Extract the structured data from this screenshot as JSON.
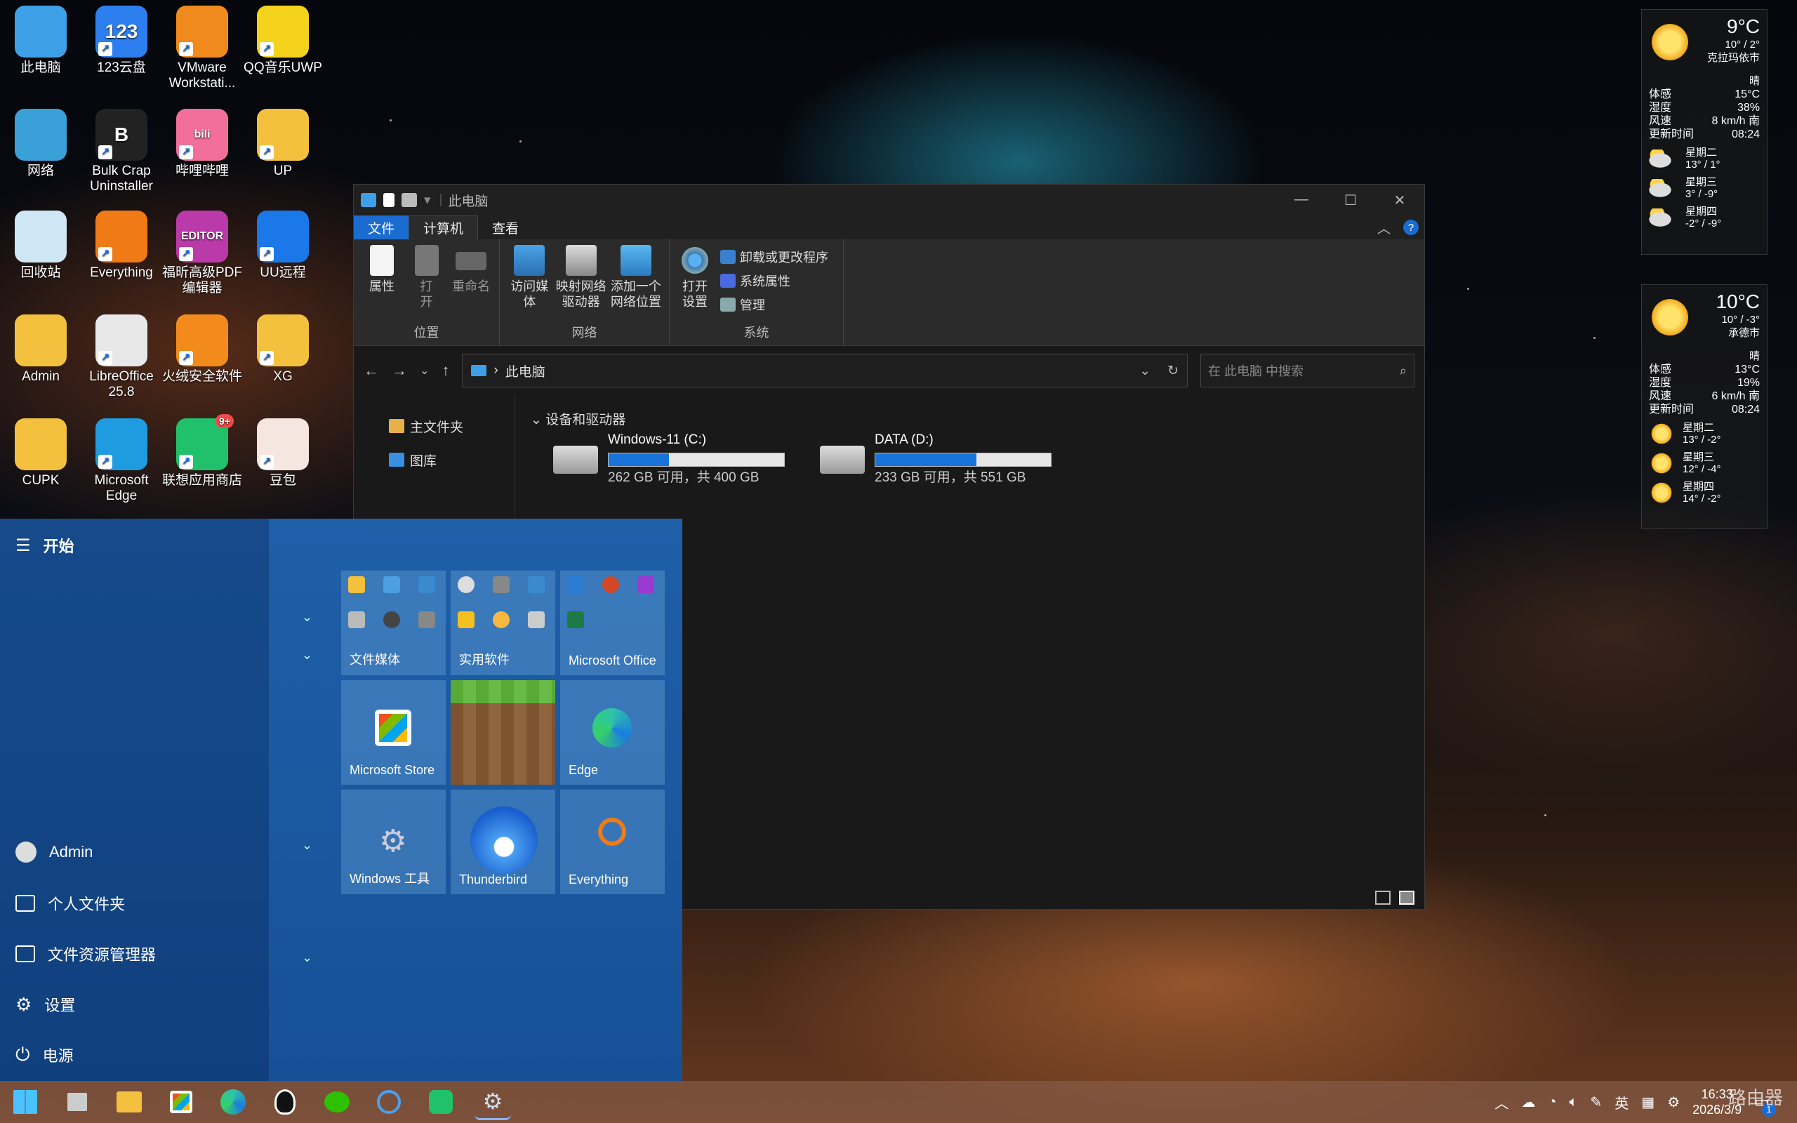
{
  "desktop": {
    "icons": [
      {
        "label": "此电脑",
        "color": "#3ea1e8"
      },
      {
        "label": "123云盘",
        "color": "#2d7ff0",
        "glyph": "123"
      },
      {
        "label": "VMware Workstati...",
        "color": "#f08a1c"
      },
      {
        "label": "QQ音乐UWP",
        "color": "#f5d31c"
      },
      {
        "label": "网络",
        "color": "#3aa0d8"
      },
      {
        "label": "Bulk Crap Uninstaller",
        "color": "#222",
        "glyph": "B"
      },
      {
        "label": "哔哩哔哩",
        "color": "#f26f9b",
        "glyph": "bili"
      },
      {
        "label": "UP",
        "color": "#f3c13e"
      },
      {
        "label": "回收站",
        "color": "#cfe6f5"
      },
      {
        "label": "Everything",
        "color": "#f07a16"
      },
      {
        "label": "福昕高级PDF编辑器",
        "color": "#b93aa8",
        "glyph": "EDITOR"
      },
      {
        "label": "UU远程",
        "color": "#1a78e8"
      },
      {
        "label": "Admin",
        "color": "#f3c13e"
      },
      {
        "label": "LibreOffice 25.8",
        "color": "#e8e8e8"
      },
      {
        "label": "火绒安全软件",
        "color": "#f28b1c"
      },
      {
        "label": "XG",
        "color": "#f3c13e"
      },
      {
        "label": "CUPK",
        "color": "#f3c13e"
      },
      {
        "label": "Microsoft Edge",
        "color": "#1f9be0"
      },
      {
        "label": "联想应用商店",
        "color": "#21c16b",
        "badge": "9+"
      },
      {
        "label": "豆包",
        "color": "#f5e6e0"
      }
    ]
  },
  "weather": [
    {
      "temp": "9°C",
      "range": "10° / 2°",
      "city": "克拉玛依市",
      "condition": "晴",
      "rows": [
        [
          "体感",
          "15°C"
        ],
        [
          "湿度",
          "38%"
        ],
        [
          "风速",
          "8 km/h 南"
        ],
        [
          "更新时间",
          "08:24"
        ]
      ],
      "forecast": [
        [
          "星期二",
          "13° / 1°"
        ],
        [
          "星期三",
          "3° / -9°"
        ],
        [
          "星期四",
          "-2° / -9°"
        ]
      ]
    },
    {
      "temp": "10°C",
      "range": "10° / -3°",
      "city": "承德市",
      "condition": "晴",
      "rows": [
        [
          "体感",
          "13°C"
        ],
        [
          "湿度",
          "19%"
        ],
        [
          "风速",
          "6 km/h 南"
        ],
        [
          "更新时间",
          "08:24"
        ]
      ],
      "forecast": [
        [
          "星期二",
          "13° / -2°"
        ],
        [
          "星期三",
          "12° / -4°"
        ],
        [
          "星期四",
          "14° / -2°"
        ]
      ]
    }
  ],
  "explorer": {
    "title": "此电脑",
    "tabs": [
      "文件",
      "计算机",
      "查看"
    ],
    "ribbon": {
      "location": {
        "name": "位置",
        "buttons": [
          "属性",
          "打\n开",
          "重命名"
        ]
      },
      "network": {
        "name": "网络",
        "buttons": [
          "访问媒体",
          "映射网络\n驱动器",
          "添加一个\n网络位置"
        ]
      },
      "system": {
        "name": "系统",
        "open_settings": "打开\n设置",
        "links": [
          "卸载或更改程序",
          "系统属性",
          "管理"
        ]
      }
    },
    "address": "此电脑",
    "search_placeholder": "在 此电脑 中搜索",
    "nav": [
      "主文件夹",
      "图库"
    ],
    "section": "设备和驱动器",
    "drives": [
      {
        "name": "Windows-11 (C:)",
        "info": "262 GB 可用，共 400 GB",
        "used": 0.345
      },
      {
        "name": "DATA (D:)",
        "info": "233 GB 可用，共 551 GB",
        "used": 0.577
      }
    ]
  },
  "start": {
    "title": "开始",
    "items": [
      "Admin",
      "个人文件夹",
      "文件资源管理器",
      "设置",
      "电源"
    ],
    "tiles": [
      "文件媒体",
      "实用软件",
      "Microsoft Office",
      "Microsoft Store",
      "",
      "Edge",
      "Windows 工具",
      "Thunderbird",
      "Everything"
    ]
  },
  "taskbar": {
    "tray": {
      "ime": "英",
      "time": "16:33",
      "date": "2026/3/9",
      "notif": "1"
    },
    "watermark": "路由器"
  }
}
